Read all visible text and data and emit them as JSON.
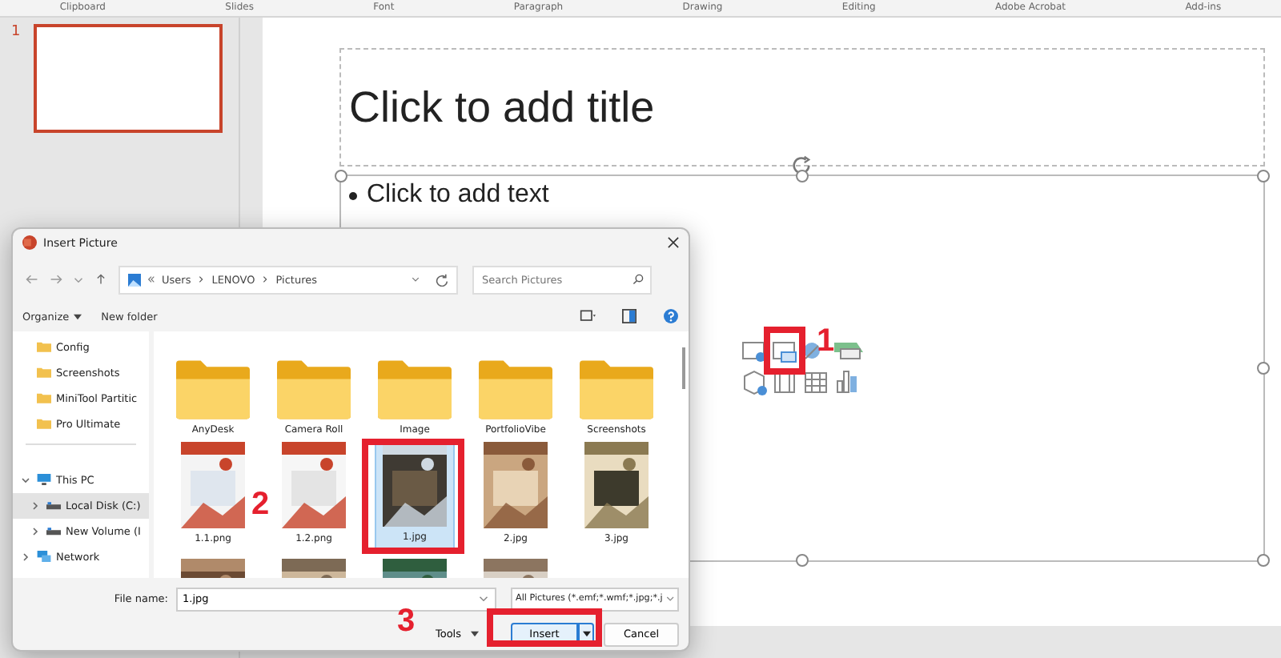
{
  "ribbon_groups": [
    "Clipboard",
    "Slides",
    "Font",
    "Paragraph",
    "Drawing",
    "Editing",
    "Adobe Acrobat",
    "Add-ins"
  ],
  "slide_thumbnails": [
    {
      "number": "1",
      "selected": true
    }
  ],
  "slide": {
    "title_placeholder": "Click to add title",
    "body_placeholder": "Click to add text"
  },
  "dialog": {
    "title": "Insert Picture",
    "breadcrumb": [
      "Users",
      "LENOVO",
      "Pictures"
    ],
    "search": {
      "placeholder": "Search Pictures"
    },
    "toolbar": [
      "Organize",
      "New folder"
    ],
    "nav_items": [
      {
        "label": "Config",
        "kind": "folder",
        "selected": false
      },
      {
        "label": "Screenshots",
        "kind": "folder",
        "selected": false
      },
      {
        "label": "MiniTool Partitic",
        "kind": "folder",
        "selected": false
      },
      {
        "label": "Pro Ultimate",
        "kind": "folder",
        "selected": false
      },
      {
        "label": "This PC",
        "kind": "pc",
        "selected": false,
        "expanded": true,
        "children": [
          {
            "label": "Local Disk (C:)",
            "kind": "drive",
            "selected": true,
            "expanded": false
          },
          {
            "label": "New Volume (I",
            "kind": "drive",
            "selected": false,
            "expanded": false
          }
        ]
      },
      {
        "label": "Network",
        "kind": "network",
        "selected": false,
        "expanded": false
      }
    ],
    "files": [
      {
        "name": "AnyDesk",
        "kind": "folder",
        "selected": false
      },
      {
        "name": "Camera Roll",
        "kind": "folder",
        "selected": false
      },
      {
        "name": "Image",
        "kind": "folder",
        "selected": false
      },
      {
        "name": "PortfolioVibe",
        "kind": "folder",
        "selected": false
      },
      {
        "name": "Screenshots",
        "kind": "folder",
        "selected": false
      },
      {
        "name": "1.1.png",
        "kind": "picture",
        "selected": false
      },
      {
        "name": "1.2.png",
        "kind": "picture",
        "selected": false
      },
      {
        "name": "1.jpg",
        "kind": "picture",
        "selected": true
      },
      {
        "name": "2.jpg",
        "kind": "picture",
        "selected": false
      },
      {
        "name": "3.jpg",
        "kind": "picture",
        "selected": false
      },
      {
        "kind": "picture",
        "selected": false
      },
      {
        "kind": "picture",
        "selected": false
      },
      {
        "kind": "picture",
        "selected": false
      },
      {
        "kind": "picture",
        "selected": false
      }
    ],
    "file_name_label": "File name:",
    "file_name": "1.jpg",
    "file_type": "All Pictures (*.emf;*.wmf;*.jpg;*.j",
    "tools": "Tools",
    "buttons": [
      "Insert",
      "Cancel"
    ]
  },
  "annotations": [
    {
      "number": "1"
    },
    {
      "number": "2"
    },
    {
      "number": "3"
    }
  ]
}
